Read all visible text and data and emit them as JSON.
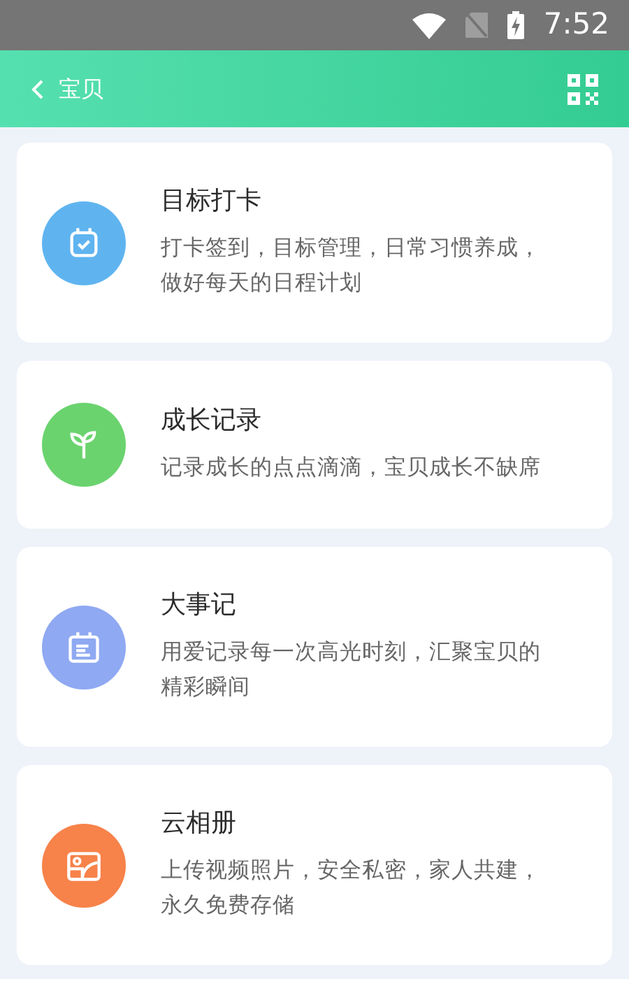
{
  "status_bar": {
    "time": "7:52"
  },
  "header": {
    "title": "宝贝"
  },
  "features": [
    {
      "kind": "checkin",
      "color": "#5fb4f0",
      "title": "目标打卡",
      "description": "打卡签到，目标管理，日常习惯养成，做好每天的日程计划"
    },
    {
      "kind": "growth",
      "color": "#6ad36e",
      "title": "成长记录",
      "description": "记录成长的点点滴滴，宝贝成长不缺席"
    },
    {
      "kind": "events",
      "color": "#8fa9f2",
      "title": "大事记",
      "description": "用爱记录每一次高光时刻，汇聚宝贝的精彩瞬间"
    },
    {
      "kind": "album",
      "color": "#f7824a",
      "title": "云相册",
      "description": "上传视频照片，安全私密，家人共建，永久免费存储"
    }
  ]
}
